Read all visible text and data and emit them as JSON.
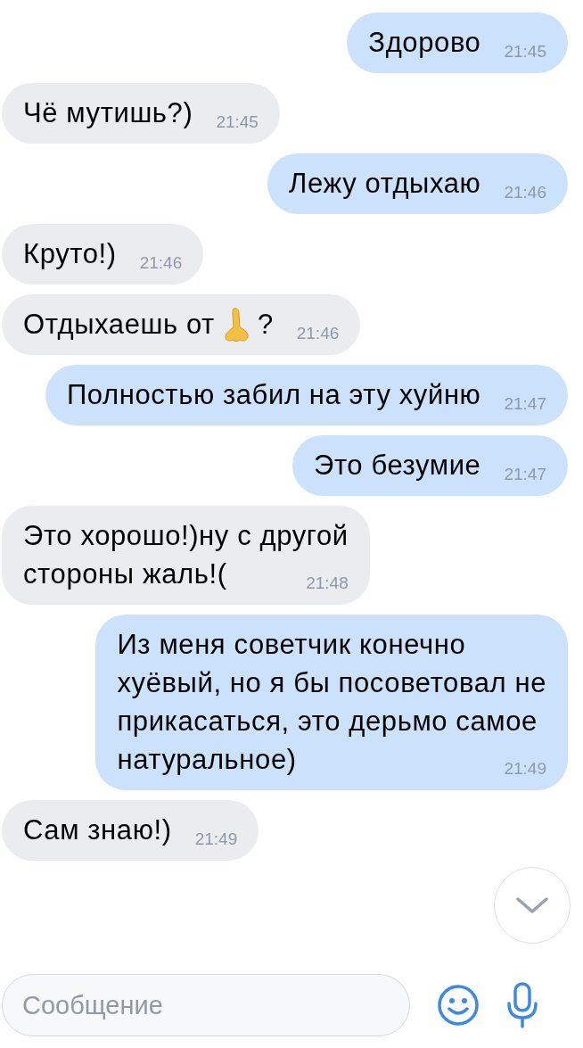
{
  "messages": [
    {
      "kind": "text",
      "outgoing": true,
      "lines": [
        "Здорово"
      ],
      "time": "21:45"
    },
    {
      "kind": "text",
      "outgoing": false,
      "lines": [
        "Чё мутишь?)"
      ],
      "time": "21:45"
    },
    {
      "kind": "text",
      "outgoing": true,
      "lines": [
        "Лежу отдыхаю"
      ],
      "time": "21:46"
    },
    {
      "kind": "text",
      "outgoing": false,
      "lines": [
        "Круто!)"
      ],
      "time": "21:46"
    },
    {
      "kind": "emoji",
      "outgoing": false,
      "lines": [
        "Отдыхаешь от"
      ],
      "text_after": "?",
      "time": "21:46"
    },
    {
      "kind": "text",
      "outgoing": true,
      "lines": [
        "Полностью забил на эту хуйню"
      ],
      "time": "21:47"
    },
    {
      "kind": "text",
      "outgoing": true,
      "lines": [
        "Это безумие"
      ],
      "time": "21:47"
    },
    {
      "kind": "text",
      "outgoing": false,
      "lines": [
        "Это хорошо!)ну с другой",
        "стороны жаль!("
      ],
      "time": "21:48"
    },
    {
      "kind": "text",
      "outgoing": true,
      "lines": [
        "Из меня советчик конечно",
        "хуёвый, но я бы посоветовал не",
        "прикасаться, это дерьмо самое",
        "натуральное)"
      ],
      "time": "21:49"
    },
    {
      "kind": "text",
      "outgoing": false,
      "lines": [
        "Сам знаю!)"
      ],
      "time": "21:49"
    }
  ],
  "composer": {
    "placeholder": "Сообщение"
  }
}
